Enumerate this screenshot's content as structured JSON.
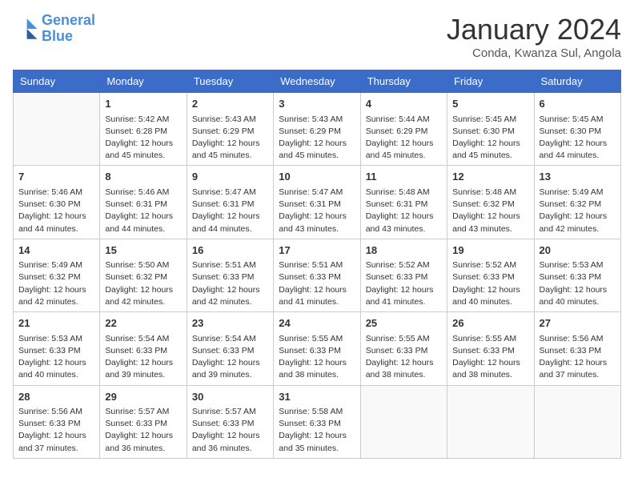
{
  "header": {
    "logo_line1": "General",
    "logo_line2": "Blue",
    "month": "January 2024",
    "location": "Conda, Kwanza Sul, Angola"
  },
  "weekdays": [
    "Sunday",
    "Monday",
    "Tuesday",
    "Wednesday",
    "Thursday",
    "Friday",
    "Saturday"
  ],
  "weeks": [
    [
      {
        "day": "",
        "info": ""
      },
      {
        "day": "1",
        "info": "Sunrise: 5:42 AM\nSunset: 6:28 PM\nDaylight: 12 hours\nand 45 minutes."
      },
      {
        "day": "2",
        "info": "Sunrise: 5:43 AM\nSunset: 6:29 PM\nDaylight: 12 hours\nand 45 minutes."
      },
      {
        "day": "3",
        "info": "Sunrise: 5:43 AM\nSunset: 6:29 PM\nDaylight: 12 hours\nand 45 minutes."
      },
      {
        "day": "4",
        "info": "Sunrise: 5:44 AM\nSunset: 6:29 PM\nDaylight: 12 hours\nand 45 minutes."
      },
      {
        "day": "5",
        "info": "Sunrise: 5:45 AM\nSunset: 6:30 PM\nDaylight: 12 hours\nand 45 minutes."
      },
      {
        "day": "6",
        "info": "Sunrise: 5:45 AM\nSunset: 6:30 PM\nDaylight: 12 hours\nand 44 minutes."
      }
    ],
    [
      {
        "day": "7",
        "info": "Sunrise: 5:46 AM\nSunset: 6:30 PM\nDaylight: 12 hours\nand 44 minutes."
      },
      {
        "day": "8",
        "info": "Sunrise: 5:46 AM\nSunset: 6:31 PM\nDaylight: 12 hours\nand 44 minutes."
      },
      {
        "day": "9",
        "info": "Sunrise: 5:47 AM\nSunset: 6:31 PM\nDaylight: 12 hours\nand 44 minutes."
      },
      {
        "day": "10",
        "info": "Sunrise: 5:47 AM\nSunset: 6:31 PM\nDaylight: 12 hours\nand 43 minutes."
      },
      {
        "day": "11",
        "info": "Sunrise: 5:48 AM\nSunset: 6:31 PM\nDaylight: 12 hours\nand 43 minutes."
      },
      {
        "day": "12",
        "info": "Sunrise: 5:48 AM\nSunset: 6:32 PM\nDaylight: 12 hours\nand 43 minutes."
      },
      {
        "day": "13",
        "info": "Sunrise: 5:49 AM\nSunset: 6:32 PM\nDaylight: 12 hours\nand 42 minutes."
      }
    ],
    [
      {
        "day": "14",
        "info": "Sunrise: 5:49 AM\nSunset: 6:32 PM\nDaylight: 12 hours\nand 42 minutes."
      },
      {
        "day": "15",
        "info": "Sunrise: 5:50 AM\nSunset: 6:32 PM\nDaylight: 12 hours\nand 42 minutes."
      },
      {
        "day": "16",
        "info": "Sunrise: 5:51 AM\nSunset: 6:33 PM\nDaylight: 12 hours\nand 42 minutes."
      },
      {
        "day": "17",
        "info": "Sunrise: 5:51 AM\nSunset: 6:33 PM\nDaylight: 12 hours\nand 41 minutes."
      },
      {
        "day": "18",
        "info": "Sunrise: 5:52 AM\nSunset: 6:33 PM\nDaylight: 12 hours\nand 41 minutes."
      },
      {
        "day": "19",
        "info": "Sunrise: 5:52 AM\nSunset: 6:33 PM\nDaylight: 12 hours\nand 40 minutes."
      },
      {
        "day": "20",
        "info": "Sunrise: 5:53 AM\nSunset: 6:33 PM\nDaylight: 12 hours\nand 40 minutes."
      }
    ],
    [
      {
        "day": "21",
        "info": "Sunrise: 5:53 AM\nSunset: 6:33 PM\nDaylight: 12 hours\nand 40 minutes."
      },
      {
        "day": "22",
        "info": "Sunrise: 5:54 AM\nSunset: 6:33 PM\nDaylight: 12 hours\nand 39 minutes."
      },
      {
        "day": "23",
        "info": "Sunrise: 5:54 AM\nSunset: 6:33 PM\nDaylight: 12 hours\nand 39 minutes."
      },
      {
        "day": "24",
        "info": "Sunrise: 5:55 AM\nSunset: 6:33 PM\nDaylight: 12 hours\nand 38 minutes."
      },
      {
        "day": "25",
        "info": "Sunrise: 5:55 AM\nSunset: 6:33 PM\nDaylight: 12 hours\nand 38 minutes."
      },
      {
        "day": "26",
        "info": "Sunrise: 5:55 AM\nSunset: 6:33 PM\nDaylight: 12 hours\nand 38 minutes."
      },
      {
        "day": "27",
        "info": "Sunrise: 5:56 AM\nSunset: 6:33 PM\nDaylight: 12 hours\nand 37 minutes."
      }
    ],
    [
      {
        "day": "28",
        "info": "Sunrise: 5:56 AM\nSunset: 6:33 PM\nDaylight: 12 hours\nand 37 minutes."
      },
      {
        "day": "29",
        "info": "Sunrise: 5:57 AM\nSunset: 6:33 PM\nDaylight: 12 hours\nand 36 minutes."
      },
      {
        "day": "30",
        "info": "Sunrise: 5:57 AM\nSunset: 6:33 PM\nDaylight: 12 hours\nand 36 minutes."
      },
      {
        "day": "31",
        "info": "Sunrise: 5:58 AM\nSunset: 6:33 PM\nDaylight: 12 hours\nand 35 minutes."
      },
      {
        "day": "",
        "info": ""
      },
      {
        "day": "",
        "info": ""
      },
      {
        "day": "",
        "info": ""
      }
    ]
  ]
}
